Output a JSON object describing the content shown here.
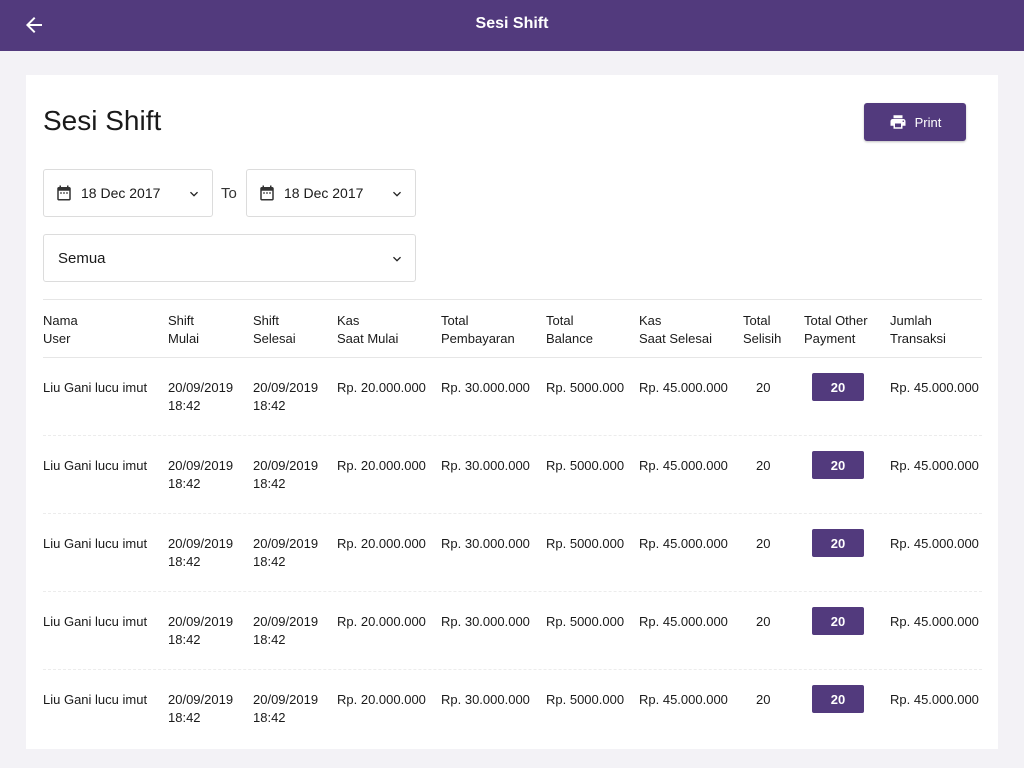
{
  "header": {
    "title": "Sesi Shift"
  },
  "page": {
    "title": "Sesi Shift"
  },
  "toolbar": {
    "print_label": "Print"
  },
  "filters": {
    "date_from": "18 Dec 2017",
    "to_label": "To",
    "date_to": "18 Dec 2017",
    "status": "Semua"
  },
  "table": {
    "columns": [
      "Nama\nUser",
      "Shift\nMulai",
      "Shift\nSelesai",
      "Kas\nSaat Mulai",
      "Total\nPembayaran",
      "Total\nBalance",
      "Kas\nSaat Selesai",
      "Total\nSelisih",
      "Total Other\nPayment",
      "Jumlah\nTransaksi"
    ],
    "rows": [
      [
        "Liu Gani lucu imut",
        "20/09/2019\n18:42",
        "20/09/2019\n18:42",
        "Rp. 20.000.000",
        "Rp. 30.000.000",
        "Rp. 5000.000",
        "Rp. 45.000.000",
        "20",
        "20",
        "Rp. 45.000.000"
      ],
      [
        "Liu Gani lucu imut",
        "20/09/2019\n18:42",
        "20/09/2019\n18:42",
        "Rp. 20.000.000",
        "Rp. 30.000.000",
        "Rp. 5000.000",
        "Rp. 45.000.000",
        "20",
        "20",
        "Rp. 45.000.000"
      ],
      [
        "Liu Gani lucu imut",
        "20/09/2019\n18:42",
        "20/09/2019\n18:42",
        "Rp. 20.000.000",
        "Rp. 30.000.000",
        "Rp. 5000.000",
        "Rp. 45.000.000",
        "20",
        "20",
        "Rp. 45.000.000"
      ],
      [
        "Liu Gani lucu imut",
        "20/09/2019\n18:42",
        "20/09/2019\n18:42",
        "Rp. 20.000.000",
        "Rp. 30.000.000",
        "Rp. 5000.000",
        "Rp. 45.000.000",
        "20",
        "20",
        "Rp. 45.000.000"
      ],
      [
        "Liu Gani lucu imut",
        "20/09/2019\n18:42",
        "20/09/2019\n18:42",
        "Rp. 20.000.000",
        "Rp. 30.000.000",
        "Rp. 5000.000",
        "Rp. 45.000.000",
        "20",
        "20",
        "Rp. 45.000.000"
      ]
    ]
  },
  "icons": {
    "back": "arrow-left-icon",
    "print": "printer-icon",
    "calendar": "calendar-icon",
    "dropdown": "chevron-down-icon"
  },
  "colors": {
    "brand": "#523a7d",
    "background": "#f3f2f6"
  }
}
